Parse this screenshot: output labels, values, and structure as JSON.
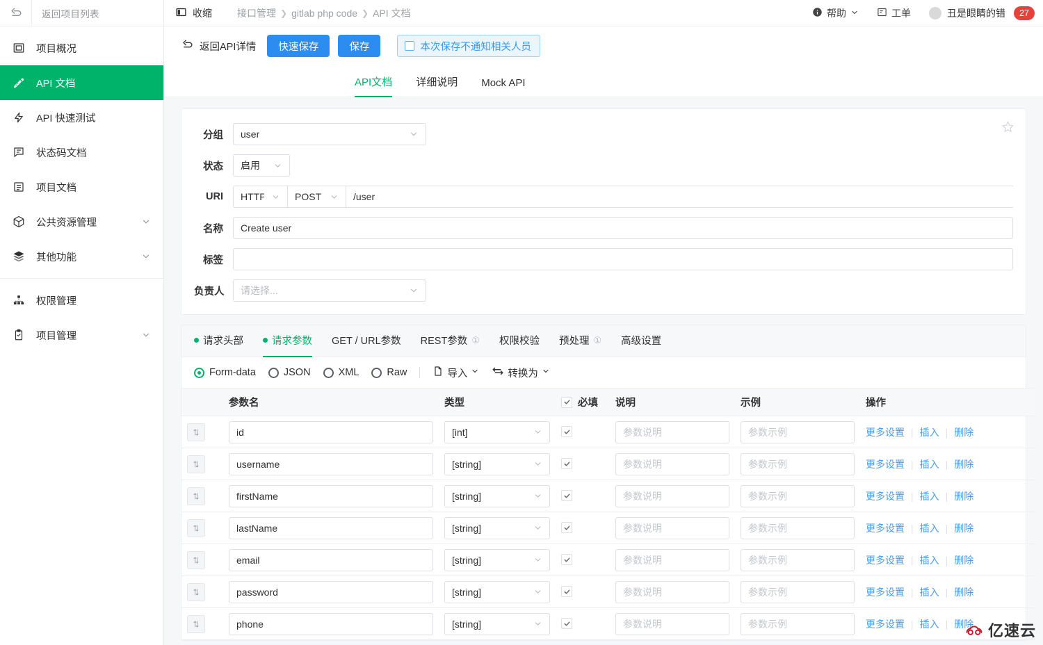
{
  "sidebar": {
    "back_icon": "back-arrow-icon",
    "back_project_label": "返回项目列表",
    "items": [
      {
        "label": "项目概况",
        "icon": "overview-icon",
        "active": false,
        "expandable": false
      },
      {
        "label": "API 文档",
        "icon": "api-doc-icon",
        "active": true,
        "expandable": false
      },
      {
        "label": "API 快速测试",
        "icon": "lightning-icon",
        "active": false,
        "expandable": false
      },
      {
        "label": "状态码文档",
        "icon": "status-code-icon",
        "active": false,
        "expandable": false
      },
      {
        "label": "项目文档",
        "icon": "document-icon",
        "active": false,
        "expandable": false
      },
      {
        "label": "公共资源管理",
        "icon": "cube-icon",
        "active": false,
        "expandable": true
      },
      {
        "label": "其他功能",
        "icon": "layers-icon",
        "active": false,
        "expandable": true
      },
      {
        "label": "权限管理",
        "icon": "org-tree-icon",
        "active": false,
        "expandable": false
      },
      {
        "label": "项目管理",
        "icon": "clipboard-icon",
        "active": false,
        "expandable": true
      }
    ]
  },
  "topbar": {
    "collapse_label": "收缩",
    "collapse_icon": "panel-collapse-icon",
    "breadcrumbs": [
      "接口管理",
      "gitlab php code",
      "API 文档"
    ],
    "help_label": "帮助",
    "help_icon": "info-circle-icon",
    "ticket_label": "工单",
    "ticket_icon": "ticket-icon",
    "user_name": "丑是眼睛的错",
    "user_badge": "27",
    "badge_color": "#e8403a"
  },
  "actionbar": {
    "back_api_label": "返回API详情",
    "back_api_icon": "back-arrow-icon",
    "quick_save_label": "快速保存",
    "save_label": "保存",
    "notify_label": "本次保存不通知相关人员",
    "notify_checked": false,
    "primary_color": "#2d8cf0"
  },
  "main_tabs": [
    {
      "label": "API文档",
      "active": true
    },
    {
      "label": "详细说明",
      "active": false
    },
    {
      "label": "Mock API",
      "active": false
    }
  ],
  "form": {
    "star_icon": "star-icon",
    "group": {
      "label": "分组",
      "value": "user",
      "placeholder": ""
    },
    "status": {
      "label": "状态",
      "value": "启用",
      "placeholder": ""
    },
    "uri": {
      "label": "URI",
      "protocol": "HTTP",
      "method": "POST",
      "path": "/user",
      "placeholder": ""
    },
    "name": {
      "label": "名称",
      "value": "Create user",
      "placeholder": ""
    },
    "tag": {
      "label": "标签",
      "value": "",
      "placeholder": ""
    },
    "owner": {
      "label": "负责人",
      "value": "",
      "placeholder": "请选择..."
    }
  },
  "param_tabs": [
    {
      "label": "请求头部",
      "active": false,
      "dot": true,
      "badge": ""
    },
    {
      "label": "请求参数",
      "active": true,
      "dot": true,
      "badge": ""
    },
    {
      "label": "GET / URL参数",
      "active": false,
      "dot": false,
      "badge": ""
    },
    {
      "label": "REST参数",
      "active": false,
      "dot": false,
      "badge": "①"
    },
    {
      "label": "权限校验",
      "active": false,
      "dot": false,
      "badge": ""
    },
    {
      "label": "预处理",
      "active": false,
      "dot": false,
      "badge": "①"
    },
    {
      "label": "高级设置",
      "active": false,
      "dot": false,
      "badge": ""
    }
  ],
  "modebar": {
    "options": [
      {
        "label": "Form-data",
        "selected": true
      },
      {
        "label": "JSON",
        "selected": false
      },
      {
        "label": "XML",
        "selected": false
      },
      {
        "label": "Raw",
        "selected": false
      }
    ],
    "import_label": "导入",
    "import_icon": "import-file-icon",
    "convert_label": "转换为",
    "convert_icon": "convert-swap-icon"
  },
  "table": {
    "headers": {
      "drag": "",
      "name": "参数名",
      "type": "类型",
      "required": "必填",
      "desc": "说明",
      "example": "示例",
      "ops": "操作"
    },
    "header_required_checked": true,
    "desc_placeholder": "参数说明",
    "example_placeholder": "参数示例",
    "ops_labels": {
      "more": "更多设置",
      "insert": "插入",
      "delete": "删除"
    },
    "rows": [
      {
        "name": "id",
        "type": "[int]",
        "required": true,
        "desc": "",
        "example": ""
      },
      {
        "name": "username",
        "type": "[string]",
        "required": true,
        "desc": "",
        "example": ""
      },
      {
        "name": "firstName",
        "type": "[string]",
        "required": true,
        "desc": "",
        "example": ""
      },
      {
        "name": "lastName",
        "type": "[string]",
        "required": true,
        "desc": "",
        "example": ""
      },
      {
        "name": "email",
        "type": "[string]",
        "required": true,
        "desc": "",
        "example": ""
      },
      {
        "name": "password",
        "type": "[string]",
        "required": true,
        "desc": "",
        "example": ""
      },
      {
        "name": "phone",
        "type": "[string]",
        "required": true,
        "desc": "",
        "example": ""
      }
    ]
  },
  "watermark": {
    "text": "亿速云",
    "logo_icon": "cloud-logo-icon",
    "color": "#c5192d"
  },
  "theme": {
    "accent_green": "#00b36b",
    "accent_blue": "#2d8cf0",
    "link_blue": "#4a9df0"
  }
}
